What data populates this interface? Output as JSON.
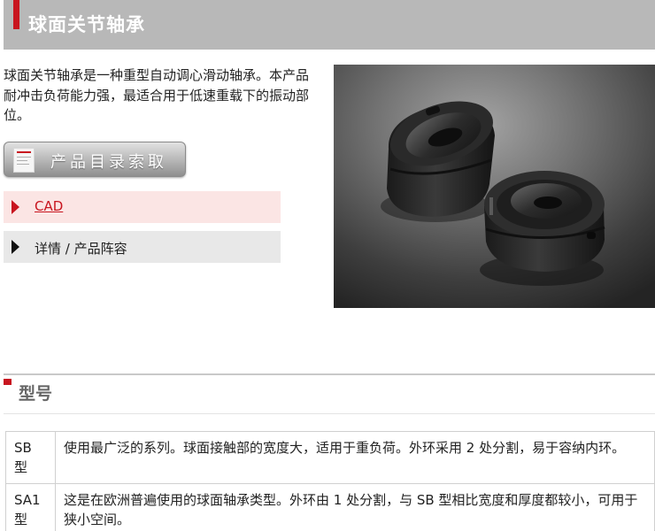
{
  "header": {
    "title": "球面关节轴承",
    "accent_color": "#c8151f",
    "bar_color": "#b8b8b8"
  },
  "intro": {
    "text": "球面关节轴承是一种重型自动调心滑动轴承。本产品耐冲击负荷能力强，最适合用于低速重载下的振动部位。"
  },
  "catalog_button": {
    "label": "产品目录索取",
    "icon": "catalog-book-icon"
  },
  "links": {
    "cad": {
      "label": "CAD",
      "icon": "triangle-right-icon",
      "color": "#c8151f"
    },
    "detail": {
      "label": "详情 / 产品阵容",
      "icon": "triangle-right-icon"
    }
  },
  "models": {
    "section_title": "型号",
    "rows": [
      {
        "code": "SB 型",
        "desc": "使用最广泛的系列。球面接触部的宽度大，适用于重负荷。外环采用 2 处分割，易于容纳内环。"
      },
      {
        "code": "SA1 型",
        "desc": "这是在欧洲普遍使用的球面轴承类型。外环由 1 处分割，与 SB 型相比宽度和厚度都较小，可用于狭小空间。"
      }
    ]
  }
}
